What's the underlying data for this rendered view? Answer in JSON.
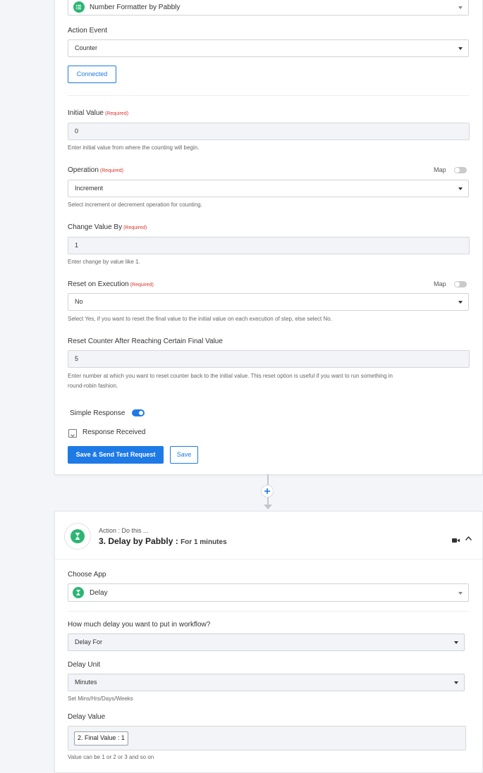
{
  "step_top": {
    "app_name": "Number Formatter by Pabbly",
    "action_event_label": "Action Event",
    "action_event_value": "Counter",
    "connected_label": "Connected",
    "map_label": "Map",
    "fields": {
      "initial_value": {
        "label": "Initial Value",
        "required": "(Required)",
        "value": "0",
        "help": "Enter initial value from where the counting will begin."
      },
      "operation": {
        "label": "Operation",
        "required": "(Required)",
        "value": "Increment",
        "help": "Select increment or decrement operation for counting."
      },
      "change_value_by": {
        "label": "Change Value By",
        "required": "(Required)",
        "value": "1",
        "help": "Enter change by value like 1."
      },
      "reset_on_execution": {
        "label": "Reset on Execution",
        "required": "(Required)",
        "value": "No",
        "help": "Select Yes, if you want to reset the final value to the initial value on each execution of step, else select No."
      },
      "reset_counter": {
        "label": "Reset Counter After Reaching Certain Final Value",
        "value": "5",
        "help_line1": "Enter number at which you want to reset counter back to the initial value. This reset option is useful if you want to run something in",
        "help_line2": "round-robin fashion."
      }
    },
    "simple_response_label": "Simple Response",
    "simple_response_on": true,
    "response_received_label": "Response Received",
    "save_send_label": "Save & Send Test Request",
    "save_label": "Save"
  },
  "connector": {
    "add_symbol": "+"
  },
  "step_delay": {
    "subtitle": "Action : Do this ...",
    "title": "3. Delay by Pabbly :",
    "title_suffix": "For 1 minutes",
    "choose_app_label": "Choose App",
    "app_value": "Delay",
    "delay_question_label": "How much delay you want to put in workflow?",
    "delay_question_value": "Delay For",
    "delay_unit_label": "Delay Unit",
    "delay_unit_value": "Minutes",
    "delay_unit_help": "Set Mins/Hrs/Days/Weeks",
    "delay_value_label": "Delay Value",
    "delay_value_token": "2. Final Value : 1",
    "delay_value_help": "Value can be 1 or 2 or 3 and so on"
  },
  "colors": {
    "accent": "#1e7ae6",
    "green": "#2cb673",
    "required": "#d9342b"
  },
  "icons": [
    "list-icon",
    "chevron-down-icon",
    "plus-icon",
    "hourglass-icon",
    "video-icon",
    "chevron-up-icon"
  ]
}
